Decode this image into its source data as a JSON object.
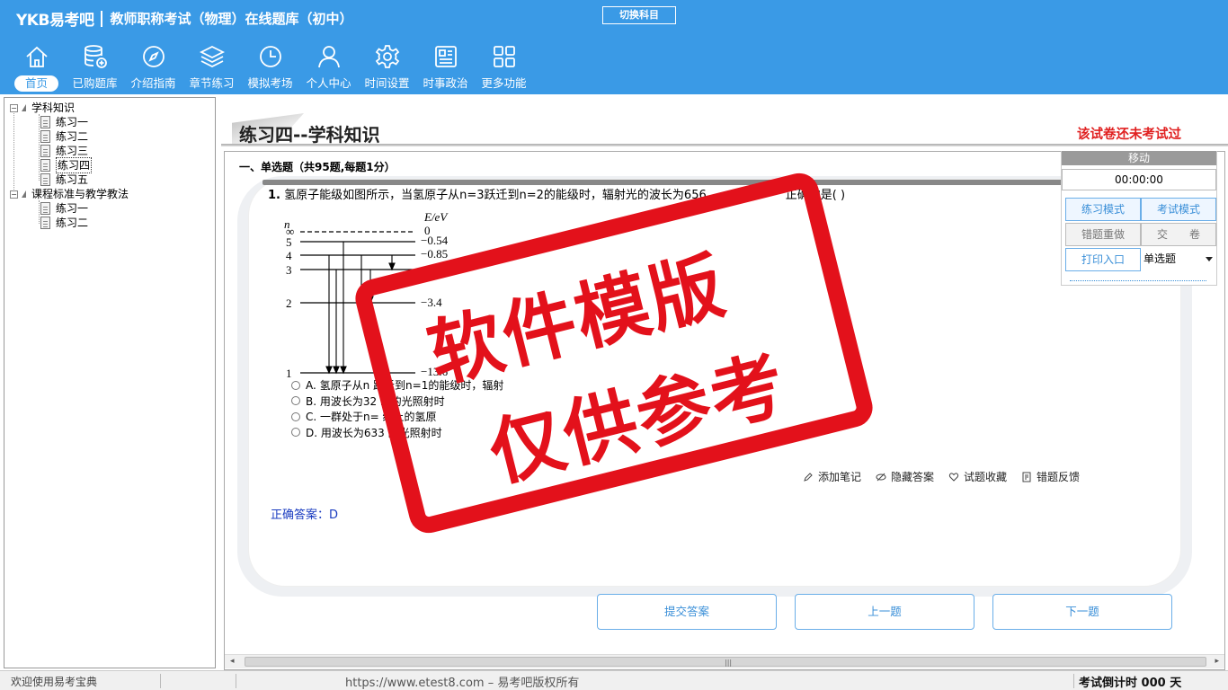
{
  "app": {
    "logo": "YKB易考吧",
    "title": "教师职称考试（物理）在线题库（初中）",
    "switch_subject": "切换科目"
  },
  "nav": [
    {
      "label": "首页",
      "icon": "home-icon",
      "active": true
    },
    {
      "label": "已购题库",
      "icon": "database-icon"
    },
    {
      "label": "介绍指南",
      "icon": "compass-icon"
    },
    {
      "label": "章节练习",
      "icon": "layers-icon"
    },
    {
      "label": "模拟考场",
      "icon": "clock-icon"
    },
    {
      "label": "个人中心",
      "icon": "user-icon"
    },
    {
      "label": "时间设置",
      "icon": "gear-icon"
    },
    {
      "label": "时事政治",
      "icon": "news-icon"
    },
    {
      "label": "更多功能",
      "icon": "grid-icon"
    }
  ],
  "tree": {
    "groups": [
      {
        "label": "学科知识",
        "items": [
          "练习一",
          "练习二",
          "练习三",
          "练习四",
          "练习五"
        ]
      },
      {
        "label": "课程标准与教学教法",
        "items": [
          "练习一",
          "练习二"
        ]
      }
    ],
    "selected": "练习四"
  },
  "exam": {
    "title": "练习四--学科知识",
    "status": "该试卷还未考试过",
    "section": "一、单选题（共95题,每题1分）"
  },
  "question": {
    "number": "1.",
    "text": "氢原子能级如图所示，当氢原子从n=3跃迁到n=2的能级时，辐射光的波长为656",
    "text_tail": "正确的是( )",
    "options": [
      "A. 氢原子从n   跃迁到n=1的能级时，辐射",
      "B. 用波长为32  m的光照射时",
      "C. 一群处于n=  级上的氢原",
      "D. 用波长为633  的光照射时"
    ],
    "actions": [
      "添加笔记",
      "隐藏答案",
      "试题收藏",
      "错题反馈"
    ],
    "answer_label": "正确答案：",
    "answer": "D",
    "diagram": {
      "axis_n": "n",
      "axis_e": "E/eV",
      "levels": [
        {
          "n": "∞",
          "e": "0"
        },
        {
          "n": "5",
          "e": "−0.54"
        },
        {
          "n": "4",
          "e": "−0.85"
        },
        {
          "n": "3",
          "e": ""
        },
        {
          "n": "2",
          "e": "−3.4"
        },
        {
          "n": "1",
          "e": "−13.6"
        }
      ]
    }
  },
  "buttons": {
    "submit": "提交答案",
    "prev": "上一题",
    "next": "下一题"
  },
  "panel": {
    "move": "移动",
    "timer": "00:00:00",
    "practice_mode": "练习模式",
    "exam_mode": "考试模式",
    "redo_wrong": "错题重做",
    "hand_in": "交　　卷",
    "print": "打印入口",
    "type_select": "单选题"
  },
  "statusbar": {
    "welcome": "欢迎使用易考宝典",
    "copyright": "https://www.etest8.com – 易考吧版权所有",
    "countdown": "考试倒计时 000 天"
  },
  "watermark": {
    "line1": "软件模版",
    "line2": "仅供参考"
  }
}
